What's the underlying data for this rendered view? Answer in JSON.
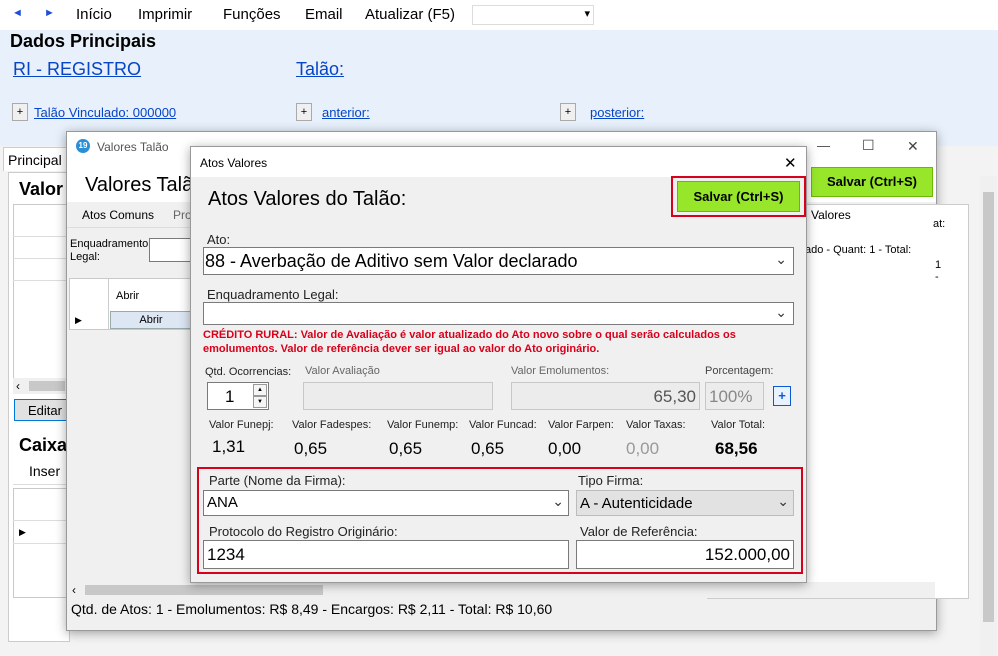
{
  "menu": {
    "inicio": "Início",
    "imprimir": "Imprimir",
    "funcoes": "Funções",
    "email": "Email",
    "atualizar": "Atualizar (F5)",
    "back": "◄",
    "forward": "►",
    "combo_arrow": "▾"
  },
  "main": {
    "dados_principais": "Dados Principais",
    "ri_registro": "RI - REGISTRO",
    "talao": "Talão:",
    "talao_vinculado": "Talão Vinculado: 000000",
    "anterior": "anterior:",
    "posterior": "posterior:",
    "plus": "+",
    "principal_tab": "Principal",
    "valor_section": "Valor",
    "editar": "Editar",
    "caixa": "Caixa",
    "inser": "Inser",
    "scroll_left": "‹"
  },
  "valores_talao": {
    "window_title": "Valores Talão",
    "heading": "Valores Talão",
    "tab_atos_comuns": "Atos Comuns",
    "tab_pro": "Pro",
    "enq_label": "Enquadramento Legal:",
    "grid_col": "Abrir",
    "grid_btn": "Abrir",
    "salvar": "Salvar (Ctrl+S)",
    "tab_valores": "Valores",
    "right_text": "ado - Quant: 1 - Total:",
    "right_text2": "1 -",
    "summary": "Qtd. de Atos: 1  -   Emolumentos: R$ 8,49   -   Encargos: R$ 2,11   -   Total: R$ 10,60",
    "minimize": "—",
    "maximize": "☐",
    "close": "✕",
    "right_peek": "at:"
  },
  "atos": {
    "window_title": "Atos Valores",
    "heading": "Atos Valores do Talão:",
    "salvar": "Salvar (Ctrl+S)",
    "close": "✕",
    "ato_label": "Ato:",
    "ato_value": "88 - Averbação de Aditivo sem Valor declarado",
    "enq_label": "Enquadramento Legal:",
    "enq_value": "",
    "credito_rural": "CRÉDITO RURAL: Valor de Avaliação é valor atualizado do Ato novo sobre o qual serão calculados os emolumentos. Valor de referência dever ser igual ao valor do Ato originário.",
    "qtd_label": "Qtd. Ocorrencias:",
    "qtd_value": "1",
    "spin_up": "▲",
    "spin_down": "▼",
    "avaliacao_label": "Valor Avaliação",
    "avaliacao_value": "",
    "emol_label": "Valor Emolumentos:",
    "emol_value": "65,30",
    "porc_label": "Porcentagem:",
    "porc_value": "100%",
    "porc_btn": "+",
    "funepj_label": "Valor Funepj:",
    "funepj_value": "1,31",
    "fadespes_label": "Valor Fadespes:",
    "fadespes_value": "0,65",
    "funemp_label": "Valor Funemp:",
    "funemp_value": "0,65",
    "funcad_label": "Valor Funcad:",
    "funcad_value": "0,65",
    "farpen_label": "Valor Farpen:",
    "farpen_value": "0,00",
    "taxas_label": "Valor Taxas:",
    "taxas_value": "0,00",
    "total_label": "Valor Total:",
    "total_value": "68,56",
    "parte_label": "Parte (Nome da Firma):",
    "parte_value": "ANA",
    "tipo_label": "Tipo Firma:",
    "tipo_value": "A - Autenticidade",
    "protocolo_label": "Protocolo do Registro Originário:",
    "protocolo_value": "1234",
    "referencia_label": "Valor de Referência:",
    "referencia_value": "152.000,00",
    "chevron": "⌄"
  },
  "colors": {
    "accent_red": "#d8001a",
    "green_button": "#97e62a",
    "link": "#0645c8",
    "red_text": "#d8001a"
  }
}
